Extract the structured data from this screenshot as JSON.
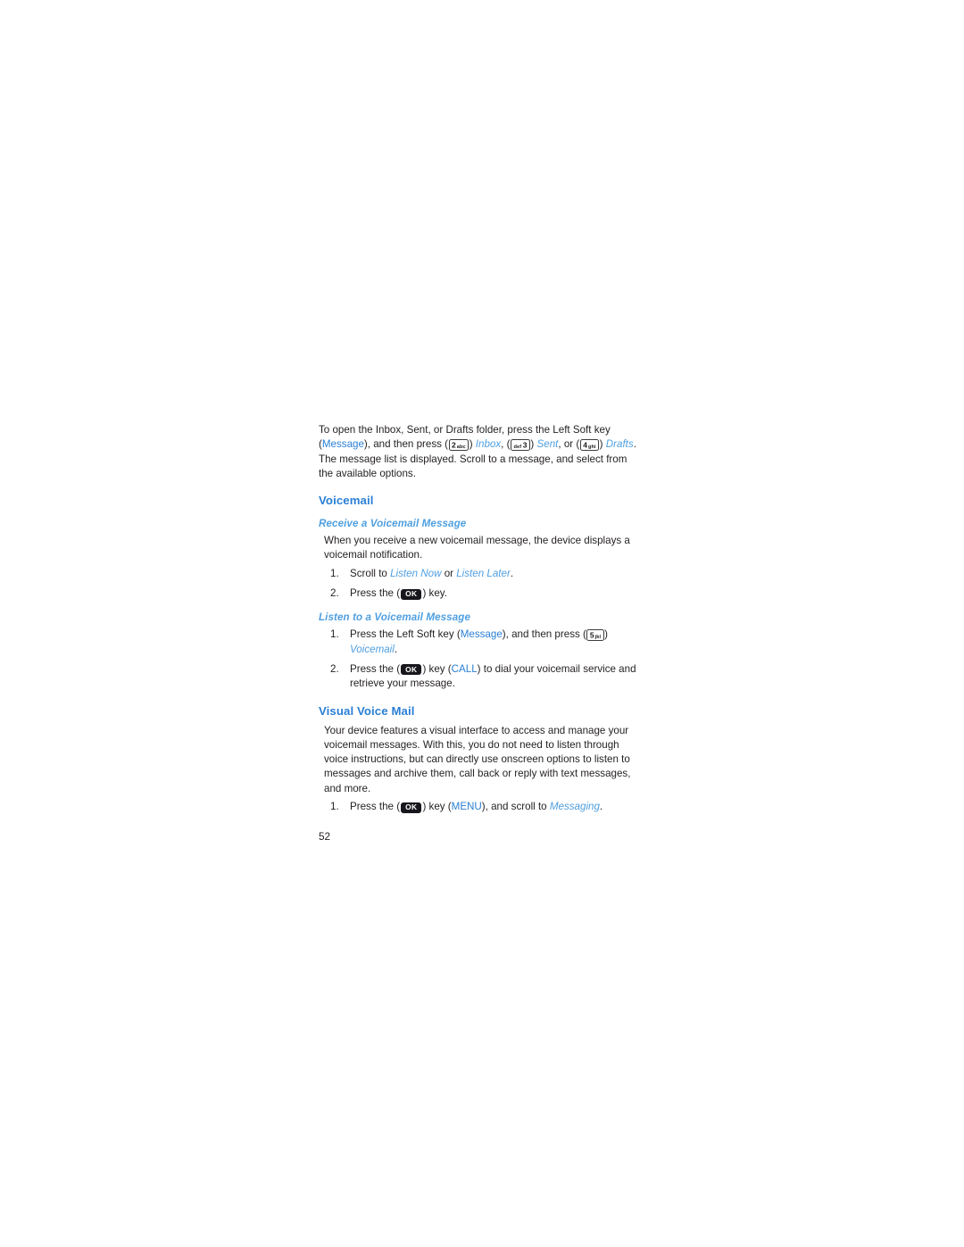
{
  "document": {
    "page_number": "52",
    "colors": {
      "heading_blue": "#2a7fd4",
      "subheading_blue": "#4f9fe0",
      "body_text": "#231f20",
      "key_dark": "#17171d",
      "page_background": "#ffffff"
    }
  },
  "intro": {
    "line1_a": "To open the Inbox, Sent, or Drafts folder, press the Left Soft key",
    "line2_open_paren": "(",
    "line2_message": "Message",
    "line2_after_message": "), and then press (",
    "key_2_digit": "2",
    "key_2_letters": "abc",
    "line2_after_key2": ") ",
    "line2_inbox": "Inbox",
    "line2_after_inbox": ", (",
    "key_3_letters": "def",
    "key_3_digit": "3",
    "line2_after_key3": ") ",
    "line2_sent": "Sent",
    "line2_after_sent": ", or (",
    "key_4_digit": "4",
    "key_4_letters": "ghi",
    "line2_close": ")",
    "line3_drafts": "Drafts",
    "line3_rest": ". The message list is displayed. Scroll to a message, and select from the available options."
  },
  "voicemail": {
    "heading": "Voicemail",
    "receive": {
      "subheading": "Receive a Voicemail Message",
      "paragraph": "When you receive a new voicemail message, the device displays a voicemail notification.",
      "steps": [
        {
          "number": "1.",
          "prefix": "Scroll to ",
          "option_a": "Listen Now",
          "middle": " or ",
          "option_b": "Listen Later",
          "suffix": "."
        },
        {
          "number": "2.",
          "prefix": "Press the (",
          "key_label": "OK",
          "suffix": ") key."
        }
      ]
    },
    "listen": {
      "subheading": "Listen to a Voicemail Message",
      "steps": [
        {
          "number": "1.",
          "prefix": "Press the Left Soft key (",
          "softkey_label": "Message",
          "middle": "), and then press (",
          "key_5_digit": "5",
          "key_5_letters": "jkl",
          "after_key": ") ",
          "target": "Voicemail",
          "suffix": "."
        },
        {
          "number": "2.",
          "prefix": "Press the (",
          "key_label": "OK",
          "middle": ") key (",
          "call_label": "CALL",
          "suffix": ") to dial your voicemail service and retrieve your message."
        }
      ]
    }
  },
  "visual_voice_mail": {
    "heading": "Visual Voice Mail",
    "paragraph": "Your device features a visual interface to access and manage your voicemail messages. With this, you do not need to listen through voice instructions, but can directly use onscreen options to listen to messages and archive them, call back or reply with text messages, and more.",
    "steps": [
      {
        "number": "1.",
        "prefix": "Press the (",
        "key_label": "OK",
        "middle": ") key (",
        "menu_label": "MENU",
        "after_menu": "), and scroll to ",
        "target": "Messaging",
        "suffix": "."
      }
    ]
  }
}
